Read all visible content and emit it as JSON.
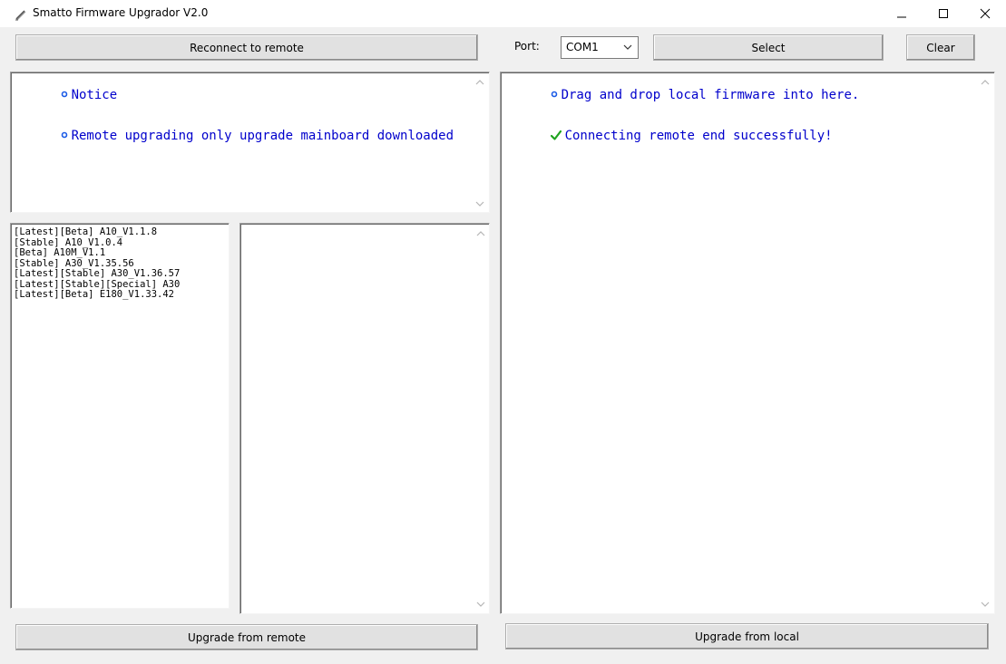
{
  "window": {
    "title": "Smatto Firmware Upgrador V2.0"
  },
  "toolbar": {
    "reconnect_label": "Reconnect to remote",
    "port_label": "Port:",
    "port_value": "COM1",
    "select_label": "Select",
    "clear_label": "Clear"
  },
  "notice_pane": {
    "lines": [
      "Notice",
      "Remote upgrading only upgrade mainboard downloaded"
    ]
  },
  "firmware_list": {
    "items": [
      "[Latest][Beta] A10_V1.1.8",
      "[Stable] A10_V1.0.4",
      "[Beta] A10M_V1.1",
      "[Stable] A30_V1.35.56",
      "[Latest][Stable] A30_V1.36.57",
      "[Latest][Stable][Special] A30",
      "[Latest][Beta] E180_V1.33.42"
    ]
  },
  "log_pane": {
    "lines": [
      {
        "icon": "info-bullet-icon",
        "text": "Drag and drop local firmware into here."
      },
      {
        "icon": "success-check-icon",
        "text": "Connecting remote end successfully!"
      }
    ]
  },
  "bottom": {
    "upgrade_remote_label": "Upgrade from remote",
    "upgrade_local_label": "Upgrade from local"
  },
  "colors": {
    "text_blue": "#0000cc",
    "check_green": "#1fa31f",
    "bullet_blue": "#1a5ae6"
  }
}
